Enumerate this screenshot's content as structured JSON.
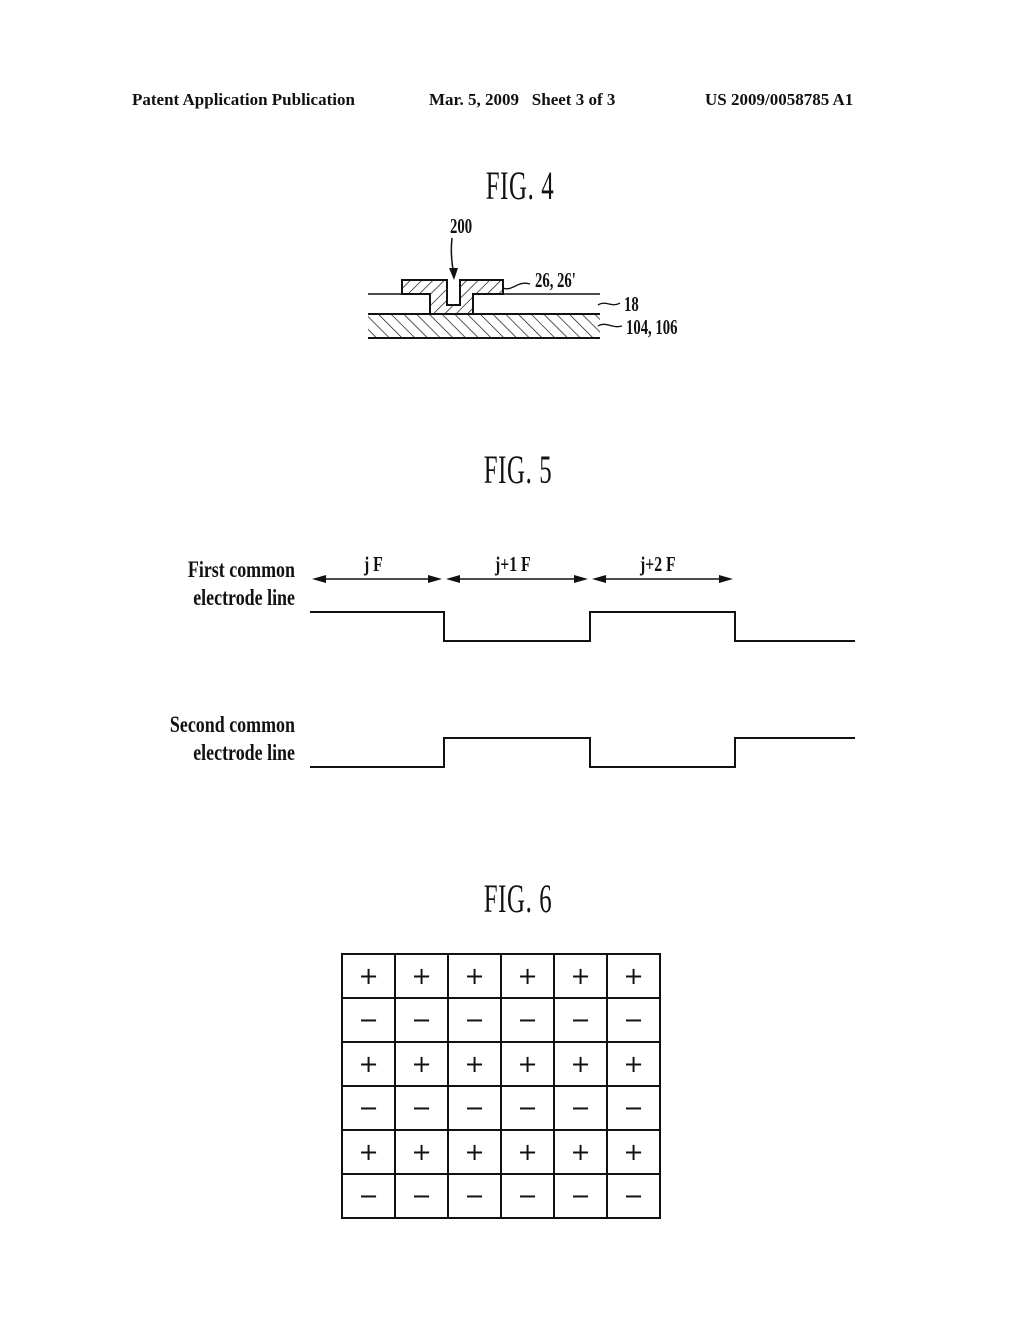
{
  "header": {
    "left": "Patent Application Publication",
    "center": "Mar. 5, 2009   Sheet 3 of 3",
    "right": "US 2009/0058785 A1"
  },
  "fig4": {
    "title": "FIG. 4",
    "labels": {
      "hole": "200",
      "top_layer": "26, 26'",
      "middle_layer": "18",
      "bottom_layer": "104, 106"
    }
  },
  "fig5": {
    "title": "FIG. 5",
    "frames": [
      "j F",
      "j+1 F",
      "j+2 F"
    ],
    "signals": [
      {
        "label_line1": "First common",
        "label_line2": "electrode line",
        "levels": [
          "high",
          "low",
          "high",
          "low"
        ]
      },
      {
        "label_line1": "Second common",
        "label_line2": "electrode line",
        "levels": [
          "low",
          "high",
          "low",
          "high"
        ]
      }
    ]
  },
  "fig6": {
    "title": "FIG. 6",
    "rows": [
      [
        "+",
        "+",
        "+",
        "+",
        "+",
        "+"
      ],
      [
        "−",
        "−",
        "−",
        "−",
        "−",
        "−"
      ],
      [
        "+",
        "+",
        "+",
        "+",
        "+",
        "+"
      ],
      [
        "−",
        "−",
        "−",
        "−",
        "−",
        "−"
      ],
      [
        "+",
        "+",
        "+",
        "+",
        "+",
        "+"
      ],
      [
        "−",
        "−",
        "−",
        "−",
        "−",
        "−"
      ]
    ]
  }
}
